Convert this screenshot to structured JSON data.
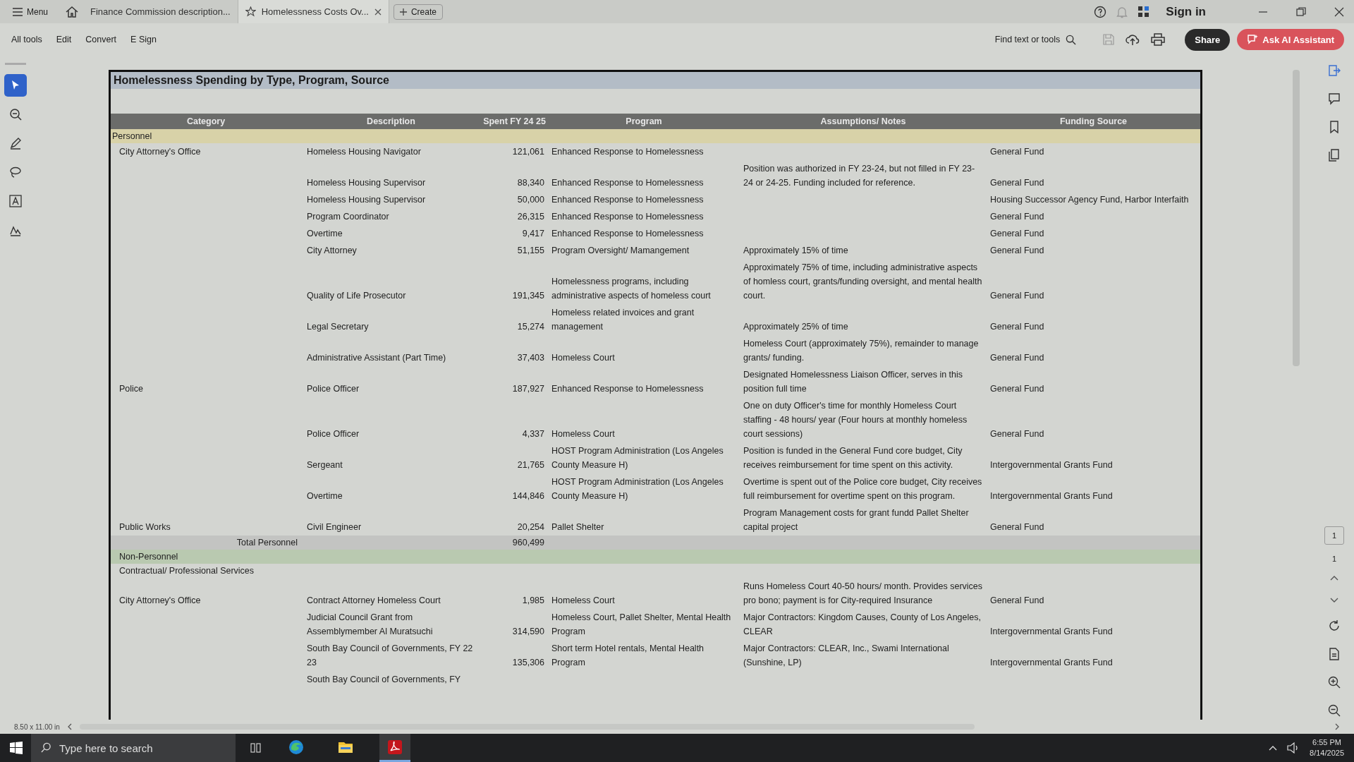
{
  "titlebar": {
    "menu_label": "Menu",
    "tabs": [
      {
        "label": "Finance Commission description...",
        "selected": false,
        "starred": false,
        "closable": false
      },
      {
        "label": "Homelessness Costs Ov...",
        "selected": true,
        "starred": true,
        "closable": true
      }
    ],
    "create_label": "Create",
    "sign_in": "Sign in"
  },
  "toolbar": {
    "items": [
      "All tools",
      "Edit",
      "Convert",
      "E Sign"
    ],
    "find_label": "Find text or tools",
    "share": "Share",
    "ai": "Ask AI Assistant"
  },
  "left_tools": [
    {
      "kind": "select",
      "selected": true
    },
    {
      "kind": "zoom",
      "selected": false
    },
    {
      "kind": "pen",
      "selected": false
    },
    {
      "kind": "lasso",
      "selected": false
    },
    {
      "kind": "text",
      "selected": false
    },
    {
      "kind": "sign",
      "selected": false
    }
  ],
  "sheet": {
    "title": "Homelessness Spending by Type, Program, Source",
    "columns": [
      "Category",
      "Description",
      "Spent FY 24 25",
      "Program",
      "Assumptions/ Notes",
      "Funding Source"
    ],
    "rows": [
      {
        "kind": "section",
        "label": "Personnel"
      },
      {
        "kind": "item",
        "category": "City Attorney's Office",
        "description": "Homeless Housing Navigator",
        "spent": "121,061",
        "program": "Enhanced Response to Homelessness",
        "funding": "General Fund"
      },
      {
        "kind": "item",
        "description": "Homeless Housing Supervisor",
        "spent": "88,340",
        "program": "Enhanced Response to Homelessness",
        "notes": "Position was authorized in FY 23-24, but not filled in FY 23-24 or 24-25. Funding included for reference.",
        "funding": "General Fund"
      },
      {
        "kind": "item",
        "description": "Homeless Housing Supervisor",
        "spent": "50,000",
        "program": "Enhanced Response to Homelessness",
        "funding": "Housing Successor Agency Fund, Harbor Interfaith"
      },
      {
        "kind": "item",
        "description": "Program Coordinator",
        "spent": "26,315",
        "program": "Enhanced Response to Homelessness",
        "funding": "General Fund"
      },
      {
        "kind": "item",
        "description": "Overtime",
        "spent": "9,417",
        "program": "Enhanced Response to Homelessness",
        "funding": "General Fund"
      },
      {
        "kind": "item",
        "description": "City Attorney",
        "spent": "51,155",
        "program": "Program Oversight/ Mamangement",
        "notes": "Approximately 15% of time",
        "funding": "General Fund"
      },
      {
        "kind": "item",
        "description": "Quality of Life Prosecutor",
        "spent": "191,345",
        "program": "Homelessness programs, including administrative aspects of homeless court",
        "notes": "Approximately 75% of time, including administrative aspects of homless court, grants/funding oversight, and mental health court.",
        "funding": "General Fund"
      },
      {
        "kind": "item",
        "description": "Legal Secretary",
        "spent": "15,274",
        "program": "Homeless related invoices and grant management",
        "notes": "Approximately 25% of time",
        "funding": "General Fund"
      },
      {
        "kind": "item",
        "description": "Administrative Assistant (Part Time)",
        "spent": "37,403",
        "program": "Homeless Court",
        "notes": "Homeless Court (approximately 75%), remainder to manage grants/ funding.",
        "funding": "General Fund"
      },
      {
        "kind": "item",
        "category": "Police",
        "description": "Police Officer",
        "spent": "187,927",
        "program": "Enhanced Response to Homelessness",
        "notes": "Designated Homelessness Liaison Officer, serves in this position full time",
        "funding": "General Fund"
      },
      {
        "kind": "item",
        "description": "Police Officer",
        "spent": "4,337",
        "program": "Homeless Court",
        "notes": "One on duty Officer's time for monthly Homeless Court staffing - 48 hours/ year (Four hours at monthly homeless court sessions)",
        "funding": "General Fund"
      },
      {
        "kind": "item",
        "description": "Sergeant",
        "spent": "21,765",
        "program": "HOST Program Administration (Los Angeles County Measure H)",
        "notes": "Position is funded in the General Fund core budget, City receives reimbursement for time spent on this activity.",
        "funding": "Intergovernmental Grants Fund"
      },
      {
        "kind": "item",
        "description": "Overtime",
        "spent": "144,846",
        "program": "HOST Program Administration (Los Angeles County Measure H)",
        "notes": "Overtime is spent out of the Police core budget, City receives full reimbursement for overtime spent on this program.",
        "funding": "Intergovernmental Grants Fund"
      },
      {
        "kind": "item",
        "category": "Public Works",
        "description": "Civil Engineer",
        "spent": "20,254",
        "program": "Pallet Shelter",
        "notes": "Program Management costs for grant fundd Pallet Shelter capital project",
        "funding": "General Fund"
      },
      {
        "kind": "total",
        "label": "Total Personnel",
        "spent": "960,499"
      },
      {
        "kind": "group",
        "label": "Non-Personnel"
      },
      {
        "kind": "subgroup",
        "label": "Contractual/ Professional Services"
      },
      {
        "kind": "item",
        "category": "City Attorney's Office",
        "description": "Contract Attorney Homeless Court",
        "spent": "1,985",
        "program": "Homeless Court",
        "notes": "Runs Homeless Court 40-50 hours/ month. Provides services pro bono; payment is for City-required Insurance",
        "funding": "General Fund"
      },
      {
        "kind": "item",
        "description": "Judicial Council Grant from Assemblymember Al Muratsuchi",
        "spent": "314,590",
        "program": "Homeless Court, Pallet Shelter, Mental Health Program",
        "notes": "Major Contractors: Kingdom Causes, County of Los Angeles, CLEAR",
        "funding": "Intergovernmental Grants Fund"
      },
      {
        "kind": "item",
        "description": "South Bay Council of Governments, FY 22 23",
        "spent": "135,306",
        "program": "Short term Hotel rentals, Mental Health Program",
        "notes": "Major Contractors: CLEAR, Inc., Swami International (Sunshine, LP)",
        "funding": "Intergovernmental Grants Fund"
      },
      {
        "kind": "item",
        "description": "South Bay Council of Governments, FY"
      }
    ]
  },
  "right_rail": {
    "page_current": "1",
    "page_total": "1"
  },
  "status": {
    "page_size": "8.50 x 11.00 in"
  },
  "taskbar": {
    "search_placeholder": "Type here to search",
    "apps": [
      {
        "kind": "edge",
        "selected": false
      },
      {
        "kind": "files",
        "selected": false
      },
      {
        "kind": "acrobat",
        "selected": true
      }
    ],
    "time": "6:55 PM",
    "date": "8/14/2025"
  }
}
